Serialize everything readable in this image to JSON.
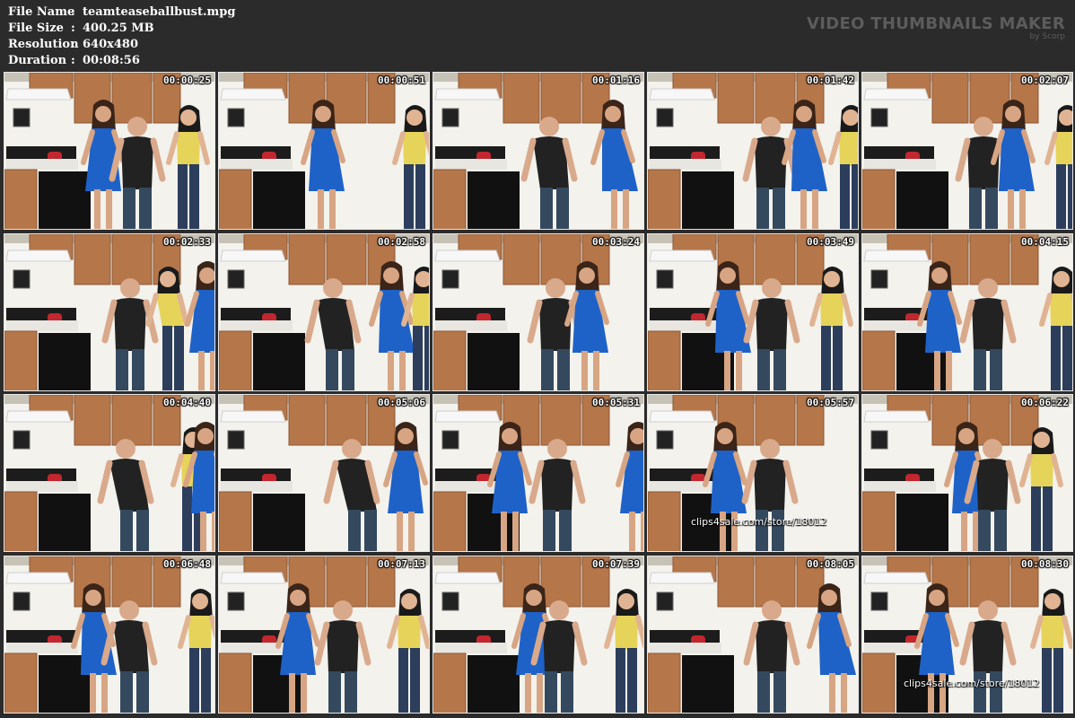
{
  "file_info": {
    "rows": [
      {
        "key": "File Name",
        "value": "teamteaseballbust.mpg"
      },
      {
        "key": "File Size",
        "value": "400.25 MB"
      },
      {
        "key": "Resolution",
        "value": "640x480"
      },
      {
        "key": "Duration",
        "value": "00:08:56"
      }
    ],
    "separator": ":"
  },
  "branding": {
    "title": "VIDEO THUMBNAILS MAKER",
    "subtitle": "by Scorp"
  },
  "thumbnails": [
    {
      "time": "00:00:25"
    },
    {
      "time": "00:00:51"
    },
    {
      "time": "00:01:16"
    },
    {
      "time": "00:01:42"
    },
    {
      "time": "00:02:07"
    },
    {
      "time": "00:02:33"
    },
    {
      "time": "00:02:58"
    },
    {
      "time": "00:03:24"
    },
    {
      "time": "00:03:49"
    },
    {
      "time": "00:04:15"
    },
    {
      "time": "00:04:40"
    },
    {
      "time": "00:05:06"
    },
    {
      "time": "00:05:31"
    },
    {
      "time": "00:05:57"
    },
    {
      "time": "00:06:22"
    },
    {
      "time": "00:06:48"
    },
    {
      "time": "00:07:13"
    },
    {
      "time": "00:07:39"
    },
    {
      "time": "00:08:05"
    },
    {
      "time": "00:08:30"
    }
  ],
  "watermarks": [
    {
      "thumb_index": 13,
      "text": "clips4sale.com/store/18012"
    },
    {
      "thumb_index": 19,
      "text": "clips4sale.com/store/18012"
    }
  ],
  "colors": {
    "background": "#2b2b2b",
    "cabinet": "#b5764a",
    "wall": "#f3f2ec",
    "dress_blue": "#1e62c8",
    "top_yellow": "#e6d35a",
    "tank_black": "#222222",
    "jeans": "#34495e"
  }
}
